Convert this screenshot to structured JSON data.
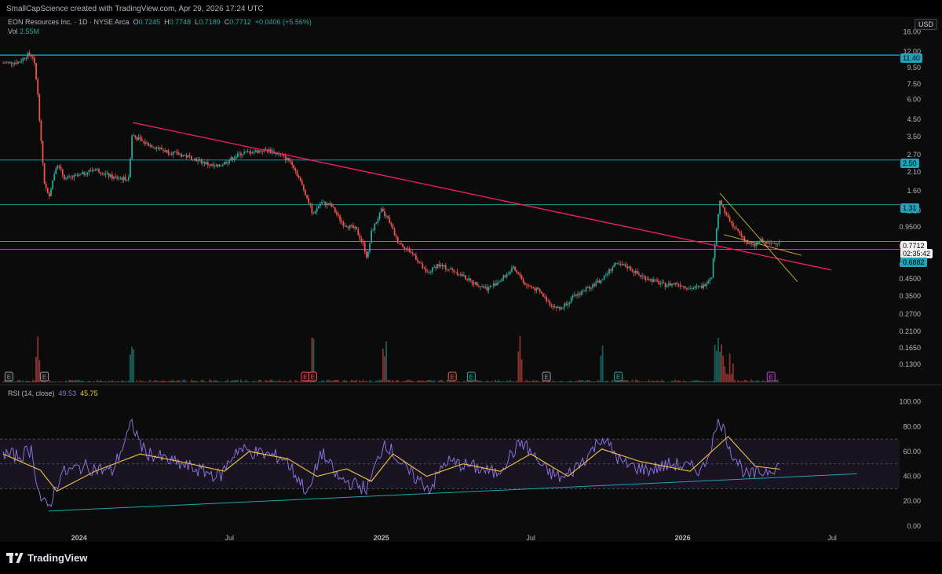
{
  "header": {
    "credit": "SmallCapScience created with TradingView.com, Apr 29, 2026 17:24 UTC",
    "symbol": "EON Resources Inc. · 1D · NYSE Arca",
    "o_label": "O",
    "o_value": "0.7245",
    "h_label": "H",
    "h_value": "0.7748",
    "l_label": "L",
    "l_value": "0.7189",
    "c_label": "C",
    "c_value": "0.7712",
    "change": "+0.0406 (+5.56%)",
    "vol_label": "Vol",
    "vol_value": "2.55M",
    "currency": "USD"
  },
  "rsi_legend": {
    "label": "RSI (14, close)",
    "rsi_value": "49.53",
    "ma_value": "45.75"
  },
  "branding": {
    "logo_text": "TradingView"
  },
  "colors": {
    "up": "#26a69a",
    "down": "#ef5350",
    "level": "#1fa3b8",
    "trend": "#e91e63",
    "wedge": "#c9b13a",
    "rsi": "#8c6fd8",
    "rsi_ma": "#f0c542"
  },
  "price_tags": {
    "level_1": "11.40",
    "level_2": "2.50",
    "level_3": "1.31",
    "last_price": "0.7712",
    "countdown": "02:35:42",
    "level_4": "0.6882"
  },
  "chart_data": [
    {
      "type": "candlestick",
      "scale": "log",
      "ylim": [
        0.105,
        17
      ],
      "y_ticks": [
        "16.00",
        "12.00",
        "9.50",
        "7.50",
        "6.00",
        "4.50",
        "3.50",
        "2.70",
        "2.10",
        "1.60",
        "1.20",
        "0.9500",
        "0.7200",
        "0.5500",
        "0.4500",
        "0.3500",
        "0.2700",
        "0.2100",
        "0.1650",
        "0.1300"
      ],
      "x_ticks": [
        "2024",
        "Jul",
        "2025",
        "Jul",
        "2026",
        "Jul"
      ],
      "series": [
        {
          "name": "",
          "points": [
            [
              "2023-10-01",
              10.2
            ],
            [
              "2023-10-20",
              10.3
            ],
            [
              "2023-11-01",
              11.6
            ],
            [
              "2023-11-07",
              11.0
            ],
            [
              "2023-11-12",
              6.5
            ],
            [
              "2023-11-16",
              3.2
            ],
            [
              "2023-11-20",
              1.8
            ],
            [
              "2023-11-25",
              1.45
            ],
            [
              "2023-12-05",
              2.4
            ],
            [
              "2023-12-15",
              1.9
            ],
            [
              "2024-01-01",
              2.0
            ],
            [
              "2024-01-20",
              2.2
            ],
            [
              "2024-02-10",
              1.95
            ],
            [
              "2024-03-01",
              1.9
            ],
            [
              "2024-03-05",
              3.6
            ],
            [
              "2024-03-20",
              3.2
            ],
            [
              "2024-04-15",
              2.85
            ],
            [
              "2024-05-15",
              2.6
            ],
            [
              "2024-06-15",
              2.25
            ],
            [
              "2024-07-15",
              2.75
            ],
            [
              "2024-08-15",
              2.9
            ],
            [
              "2024-09-01",
              2.7
            ],
            [
              "2024-09-15",
              2.4
            ],
            [
              "2024-10-01",
              1.55
            ],
            [
              "2024-10-10",
              1.15
            ],
            [
              "2024-10-20",
              1.35
            ],
            [
              "2024-11-01",
              1.3
            ],
            [
              "2024-11-15",
              1.0
            ],
            [
              "2024-12-01",
              0.92
            ],
            [
              "2024-12-10",
              0.74
            ],
            [
              "2024-12-15",
              0.6
            ],
            [
              "2024-12-20",
              0.88
            ],
            [
              "2025-01-01",
              1.2
            ],
            [
              "2025-01-10",
              1.05
            ],
            [
              "2025-01-20",
              0.78
            ],
            [
              "2025-02-10",
              0.63
            ],
            [
              "2025-02-25",
              0.48
            ],
            [
              "2025-03-10",
              0.55
            ],
            [
              "2025-04-01",
              0.5
            ],
            [
              "2025-04-20",
              0.43
            ],
            [
              "2025-05-10",
              0.39
            ],
            [
              "2025-05-25",
              0.44
            ],
            [
              "2025-06-10",
              0.52
            ],
            [
              "2025-06-25",
              0.41
            ],
            [
              "2025-07-10",
              0.38
            ],
            [
              "2025-07-25",
              0.31
            ],
            [
              "2025-08-05",
              0.29
            ],
            [
              "2025-08-20",
              0.34
            ],
            [
              "2025-09-10",
              0.4
            ],
            [
              "2025-09-25",
              0.44
            ],
            [
              "2025-10-10",
              0.55
            ],
            [
              "2025-10-25",
              0.54
            ],
            [
              "2025-11-10",
              0.47
            ],
            [
              "2025-11-25",
              0.44
            ],
            [
              "2025-12-10",
              0.41
            ],
            [
              "2025-12-25",
              0.42
            ],
            [
              "2026-01-10",
              0.39
            ],
            [
              "2026-01-25",
              0.4
            ],
            [
              "2026-02-05",
              0.47
            ],
            [
              "2026-02-10",
              0.85
            ],
            [
              "2026-02-15",
              1.4
            ],
            [
              "2026-02-20",
              1.2
            ],
            [
              "2026-02-28",
              1.0
            ],
            [
              "2026-03-10",
              0.88
            ],
            [
              "2026-03-20",
              0.75
            ],
            [
              "2026-03-28",
              0.72
            ],
            [
              "2026-04-05",
              0.78
            ],
            [
              "2026-04-15",
              0.74
            ],
            [
              "2026-04-29",
              0.7712
            ]
          ]
        }
      ],
      "levels": [
        11.4,
        2.5,
        1.31,
        0.7712,
        0.6882
      ],
      "trendlines": [
        {
          "from": [
            "2024-03-06",
            4.3
          ],
          "to": [
            "2026-06-30",
            0.51
          ]
        },
        {
          "from": [
            "2026-02-15",
            1.55
          ],
          "to": [
            "2026-05-20",
            0.43
          ]
        },
        {
          "from": [
            "2026-02-20",
            0.85
          ],
          "to": [
            "2026-05-25",
            0.63
          ]
        }
      ],
      "event_markers": [
        {
          "date": "2023-10-08",
          "label": "E",
          "kind": "neutral"
        },
        {
          "date": "2023-11-20",
          "label": "E",
          "kind": "neutral"
        },
        {
          "date": "2024-10-01",
          "label": "E",
          "kind": "down"
        },
        {
          "date": "2024-10-10",
          "label": "E",
          "kind": "down"
        },
        {
          "date": "2025-03-28",
          "label": "E",
          "kind": "down"
        },
        {
          "date": "2025-04-20",
          "label": "E",
          "kind": "up"
        },
        {
          "date": "2025-07-20",
          "label": "E",
          "kind": "neutral"
        },
        {
          "date": "2025-10-15",
          "label": "E",
          "kind": "up"
        },
        {
          "date": "2026-04-18",
          "label": "E",
          "kind": "future"
        }
      ]
    },
    {
      "type": "line",
      "name": "RSI (14, close)",
      "ylim": [
        -2,
        108
      ],
      "y_ticks": [
        "100.00",
        "80.00",
        "60.00",
        "40.00",
        "20.00",
        "0.00"
      ],
      "bands": [
        30,
        50,
        70
      ],
      "series": [
        {
          "name": "",
          "points": [
            [
              "2023-10-01",
              58
            ],
            [
              "2023-10-20",
              56
            ],
            [
              "2023-11-05",
              62
            ],
            [
              "2023-11-12",
              30
            ],
            [
              "2023-11-18",
              18
            ],
            [
              "2023-11-25",
              15
            ],
            [
              "2023-12-10",
              42
            ],
            [
              "2024-01-05",
              48
            ],
            [
              "2024-02-10",
              44
            ],
            [
              "2024-03-05",
              82
            ],
            [
              "2024-03-20",
              60
            ],
            [
              "2024-04-20",
              52
            ],
            [
              "2024-05-20",
              46
            ],
            [
              "2024-06-20",
              40
            ],
            [
              "2024-07-10",
              62
            ],
            [
              "2024-08-10",
              58
            ],
            [
              "2024-09-05",
              55
            ],
            [
              "2024-10-05",
              26
            ],
            [
              "2024-10-20",
              60
            ],
            [
              "2024-11-10",
              38
            ],
            [
              "2024-12-15",
              30
            ],
            [
              "2025-01-05",
              68
            ],
            [
              "2025-02-01",
              44
            ],
            [
              "2025-03-01",
              30
            ],
            [
              "2025-03-20",
              52
            ],
            [
              "2025-04-20",
              48
            ],
            [
              "2025-05-20",
              42
            ],
            [
              "2025-06-20",
              68
            ],
            [
              "2025-07-20",
              44
            ],
            [
              "2025-08-10",
              38
            ],
            [
              "2025-09-10",
              58
            ],
            [
              "2025-09-25",
              72
            ],
            [
              "2025-10-20",
              50
            ],
            [
              "2025-11-20",
              45
            ],
            [
              "2025-12-20",
              50
            ],
            [
              "2026-01-25",
              45
            ],
            [
              "2026-02-15",
              86
            ],
            [
              "2026-03-01",
              60
            ],
            [
              "2026-03-20",
              40
            ],
            [
              "2026-04-10",
              44
            ],
            [
              "2026-04-29",
              49.53
            ]
          ]
        }
      ],
      "ma_series": [
        [
          "2023-10-01",
          58
        ],
        [
          "2023-11-15",
          45
        ],
        [
          "2023-12-05",
          28
        ],
        [
          "2024-01-20",
          44
        ],
        [
          "2024-03-15",
          58
        ],
        [
          "2024-05-01",
          52
        ],
        [
          "2024-06-25",
          44
        ],
        [
          "2024-07-25",
          60
        ],
        [
          "2024-09-10",
          54
        ],
        [
          "2024-10-15",
          40
        ],
        [
          "2024-11-20",
          46
        ],
        [
          "2024-12-20",
          36
        ],
        [
          "2025-01-15",
          58
        ],
        [
          "2025-02-25",
          40
        ],
        [
          "2025-04-10",
          50
        ],
        [
          "2025-05-25",
          44
        ],
        [
          "2025-07-01",
          58
        ],
        [
          "2025-08-15",
          40
        ],
        [
          "2025-09-25",
          62
        ],
        [
          "2025-11-10",
          52
        ],
        [
          "2026-01-10",
          44
        ],
        [
          "2026-02-25",
          72
        ],
        [
          "2026-03-30",
          48
        ],
        [
          "2026-04-29",
          45.75
        ]
      ],
      "support_line": {
        "from": [
          "2023-11-25",
          12
        ],
        "to": [
          "2026-07-31",
          42
        ]
      }
    }
  ]
}
